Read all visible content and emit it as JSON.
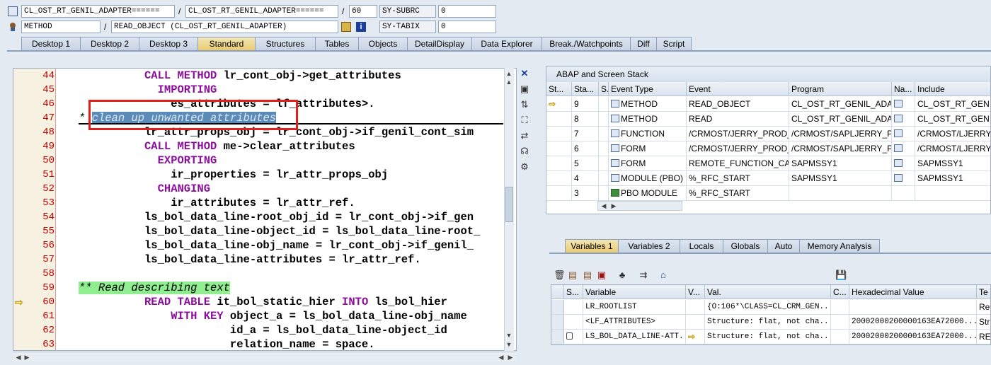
{
  "header": {
    "program_1": "CL_OST_RT_GENIL_ADAPTER======",
    "program_2": "CL_OST_RT_GENIL_ADAPTER======",
    "line": "60",
    "sysubrc_label": "SY-SUBRC",
    "sysubrc_value": "0",
    "event_type": "METHOD",
    "event": "READ_OBJECT (CL_OST_RT_GENIL_ADAPTER)",
    "sytabix_label": "SY-TABIX",
    "sytabix_value": "0",
    "sep": "/"
  },
  "tabs": [
    "Desktop 1",
    "Desktop 2",
    "Desktop 3",
    "Standard",
    "Structures",
    "Tables",
    "Objects",
    "DetailDisplay",
    "Data Explorer",
    "Break./Watchpoints",
    "Diff",
    "Script"
  ],
  "active_tab": "Standard",
  "editor": {
    "lines": [
      {
        "num": "44",
        "indent": 10,
        "parts": [
          {
            "t": "CALL METHOD",
            "c": "kw"
          },
          {
            "t": " lr_cont_obj->get_attributes"
          }
        ]
      },
      {
        "num": "45",
        "indent": 12,
        "parts": [
          {
            "t": "IMPORTING",
            "c": "kw"
          }
        ]
      },
      {
        "num": "46",
        "indent": 14,
        "parts": [
          {
            "t": "es_attributes = lf_attributes>."
          }
        ]
      },
      {
        "num": "47",
        "indent": 0,
        "parts": [
          {
            "t": "* ",
            "c": "cm"
          },
          {
            "t": "clean up unwanted attributes",
            "c": "cm hl1"
          }
        ]
      },
      {
        "num": "48",
        "indent": 10,
        "parts": [
          {
            "t": "lr_attr_props_obj = lr_cont_obj->if_genil_cont_sim"
          }
        ]
      },
      {
        "num": "49",
        "indent": 10,
        "parts": [
          {
            "t": "CALL METHOD",
            "c": "kw"
          },
          {
            "t": " me->clear_attributes"
          }
        ]
      },
      {
        "num": "50",
        "indent": 12,
        "parts": [
          {
            "t": "EXPORTING",
            "c": "kw"
          }
        ]
      },
      {
        "num": "51",
        "indent": 14,
        "parts": [
          {
            "t": "ir_properties = lr_attr_props_obj"
          }
        ]
      },
      {
        "num": "52",
        "indent": 12,
        "parts": [
          {
            "t": "CHANGING",
            "c": "kw"
          }
        ]
      },
      {
        "num": "53",
        "indent": 14,
        "parts": [
          {
            "t": "ir_attributes = lr_attr_ref."
          }
        ]
      },
      {
        "num": "54",
        "indent": 10,
        "parts": [
          {
            "t": "ls_bol_data_line-root_obj_id = lr_cont_obj->if_gen"
          }
        ]
      },
      {
        "num": "55",
        "indent": 10,
        "parts": [
          {
            "t": "ls_bol_data_line-object_id = ls_bol_data_line-root_"
          }
        ]
      },
      {
        "num": "56",
        "indent": 10,
        "parts": [
          {
            "t": "ls_bol_data_line-obj_name = lr_cont_obj->if_genil_"
          }
        ]
      },
      {
        "num": "57",
        "indent": 10,
        "parts": [
          {
            "t": "ls_bol_data_line-attributes = lr_attr_ref."
          }
        ]
      },
      {
        "num": "58",
        "indent": 0,
        "parts": [
          {
            "t": ""
          }
        ]
      },
      {
        "num": "59",
        "indent": 0,
        "parts": [
          {
            "t": "** Read describing text",
            "c": "cm hl2"
          }
        ]
      },
      {
        "num": "60",
        "indent": 10,
        "parts": [
          {
            "t": "READ TABLE",
            "c": "kw"
          },
          {
            "t": " it_bol_static_hier "
          },
          {
            "t": "INTO",
            "c": "kw"
          },
          {
            "t": " ls_bol_hier"
          }
        ]
      },
      {
        "num": "61",
        "indent": 14,
        "parts": [
          {
            "t": "WITH KEY",
            "c": "kw"
          },
          {
            "t": " object_a = ls_bol_data_line-obj_name"
          }
        ]
      },
      {
        "num": "62",
        "indent": 23,
        "parts": [
          {
            "t": "id_a = ls_bol_data_line-object_id"
          }
        ]
      },
      {
        "num": "63",
        "indent": 23,
        "parts": [
          {
            "t": "relation_name = space."
          }
        ]
      }
    ],
    "current_line": "60",
    "arrow": "⇨"
  },
  "stack": {
    "title": "ABAP and Screen Stack",
    "columns": [
      "St...",
      "Sta...",
      "S...",
      "Event Type",
      "Event",
      "Program",
      "Na...",
      "Include"
    ],
    "rows": [
      {
        "level": "9",
        "etype": "METHOD",
        "event": "READ_OBJECT",
        "program": "CL_OST_RT_GENIL_ADA...",
        "include": "CL_OST_RT_GENIL_",
        "icon": "event",
        "nav": true,
        "current": true
      },
      {
        "level": "8",
        "etype": "METHOD",
        "event": "READ",
        "program": "CL_OST_RT_GENIL_ADA...",
        "include": "CL_OST_RT_GENIL_",
        "icon": "event",
        "nav": true,
        "current": false
      },
      {
        "level": "7",
        "etype": "FUNCTION",
        "event": "/CRMOST/JERRY_PROD_...",
        "program": "/CRMOST/SAPLJERRY_P...",
        "include": "/CRMOST/LJERRY_",
        "icon": "event",
        "nav": true,
        "current": false
      },
      {
        "level": "6",
        "etype": "FORM",
        "event": "/CRMOST/JERRY_PROD_...",
        "program": "/CRMOST/SAPLJERRY_P...",
        "include": "/CRMOST/LJERRY_",
        "icon": "event",
        "nav": true,
        "current": false
      },
      {
        "level": "5",
        "etype": "FORM",
        "event": "REMOTE_FUNCTION_CA...",
        "program": "SAPMSSY1",
        "include": "SAPMSSY1",
        "icon": "event",
        "nav": true,
        "current": false
      },
      {
        "level": "4",
        "etype": "MODULE (PBO)",
        "event": "%_RFC_START",
        "program": "SAPMSSY1",
        "include": "SAPMSSY1",
        "icon": "event",
        "nav": true,
        "current": false
      },
      {
        "level": "3",
        "etype": "PBO MODULE",
        "event": "%_RFC_START",
        "program": "",
        "include": "",
        "icon": "pbo",
        "nav": false,
        "current": false
      }
    ]
  },
  "var_tabs": [
    "Variables 1",
    "Variables 2",
    "Locals",
    "Globals",
    "Auto",
    "Memory Analysis"
  ],
  "active_var_tab": "Variables 1",
  "vars": {
    "columns": [
      "S...",
      "Variable",
      "V...",
      "Val.",
      "C...",
      "Hexadecimal Value",
      "Te"
    ],
    "rows": [
      {
        "name": "LR_ROOTLIST",
        "val": "{O:106*\\CLASS=CL_CRM_GEN...",
        "hex": "",
        "te": "Ref"
      },
      {
        "name": "<LF_ATTRIBUTES>",
        "val": "Structure: flat, not cha...",
        "hex": "20002000200000163EA72000...",
        "te": "Stru"
      },
      {
        "name": "LS_BOL_DATA_LINE-ATT...",
        "val": "Structure: flat, not cha...",
        "hex": "20002000200000163EA72000...",
        "te": "REF"
      }
    ]
  },
  "colors": {
    "keyword": "#8b0f9c",
    "linenum": "#c00000",
    "highlight": "#5c8bb7",
    "comment_bg": "#90ee90",
    "active_tab": "#e9c96c"
  }
}
